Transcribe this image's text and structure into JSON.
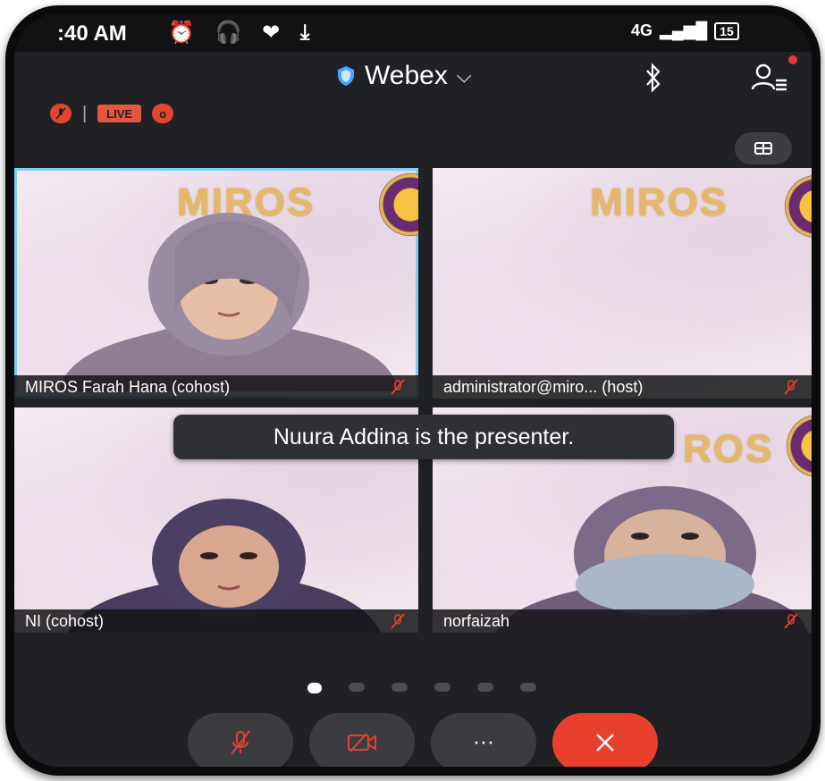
{
  "status": {
    "time": ":40 AM",
    "icons": "⏰ 🎧 ❤ ⤓",
    "network": "4G",
    "battery": "15"
  },
  "header": {
    "app_title": "Webex",
    "chevron": "⌵"
  },
  "indicators": {
    "live_label": "LIVE",
    "left_badge": "ᐧ",
    "right_badge": "o"
  },
  "tiles": [
    {
      "name": "MIROS Farah Hana (cohost)",
      "logo": "MIROS"
    },
    {
      "name": "administrator@miro... (host)",
      "logo": "MIROS"
    },
    {
      "name": "NI (cohost)"
    },
    {
      "name": "norfaizah",
      "logo": "ROS"
    }
  ],
  "toast": "Nuura Addina is the presenter.",
  "controls": {
    "more_label": "···"
  },
  "pager": {
    "pages": 6,
    "current": 1
  },
  "colors": {
    "live": "#e4573f",
    "end_call": "#e8402c",
    "active_border": "#7fd0f0"
  },
  "icon_names": [
    "shield-icon",
    "bluetooth-icon",
    "participants-icon",
    "layout-grid-icon",
    "mic-muted-icon",
    "video-off-icon",
    "more-icon",
    "close-icon"
  ]
}
